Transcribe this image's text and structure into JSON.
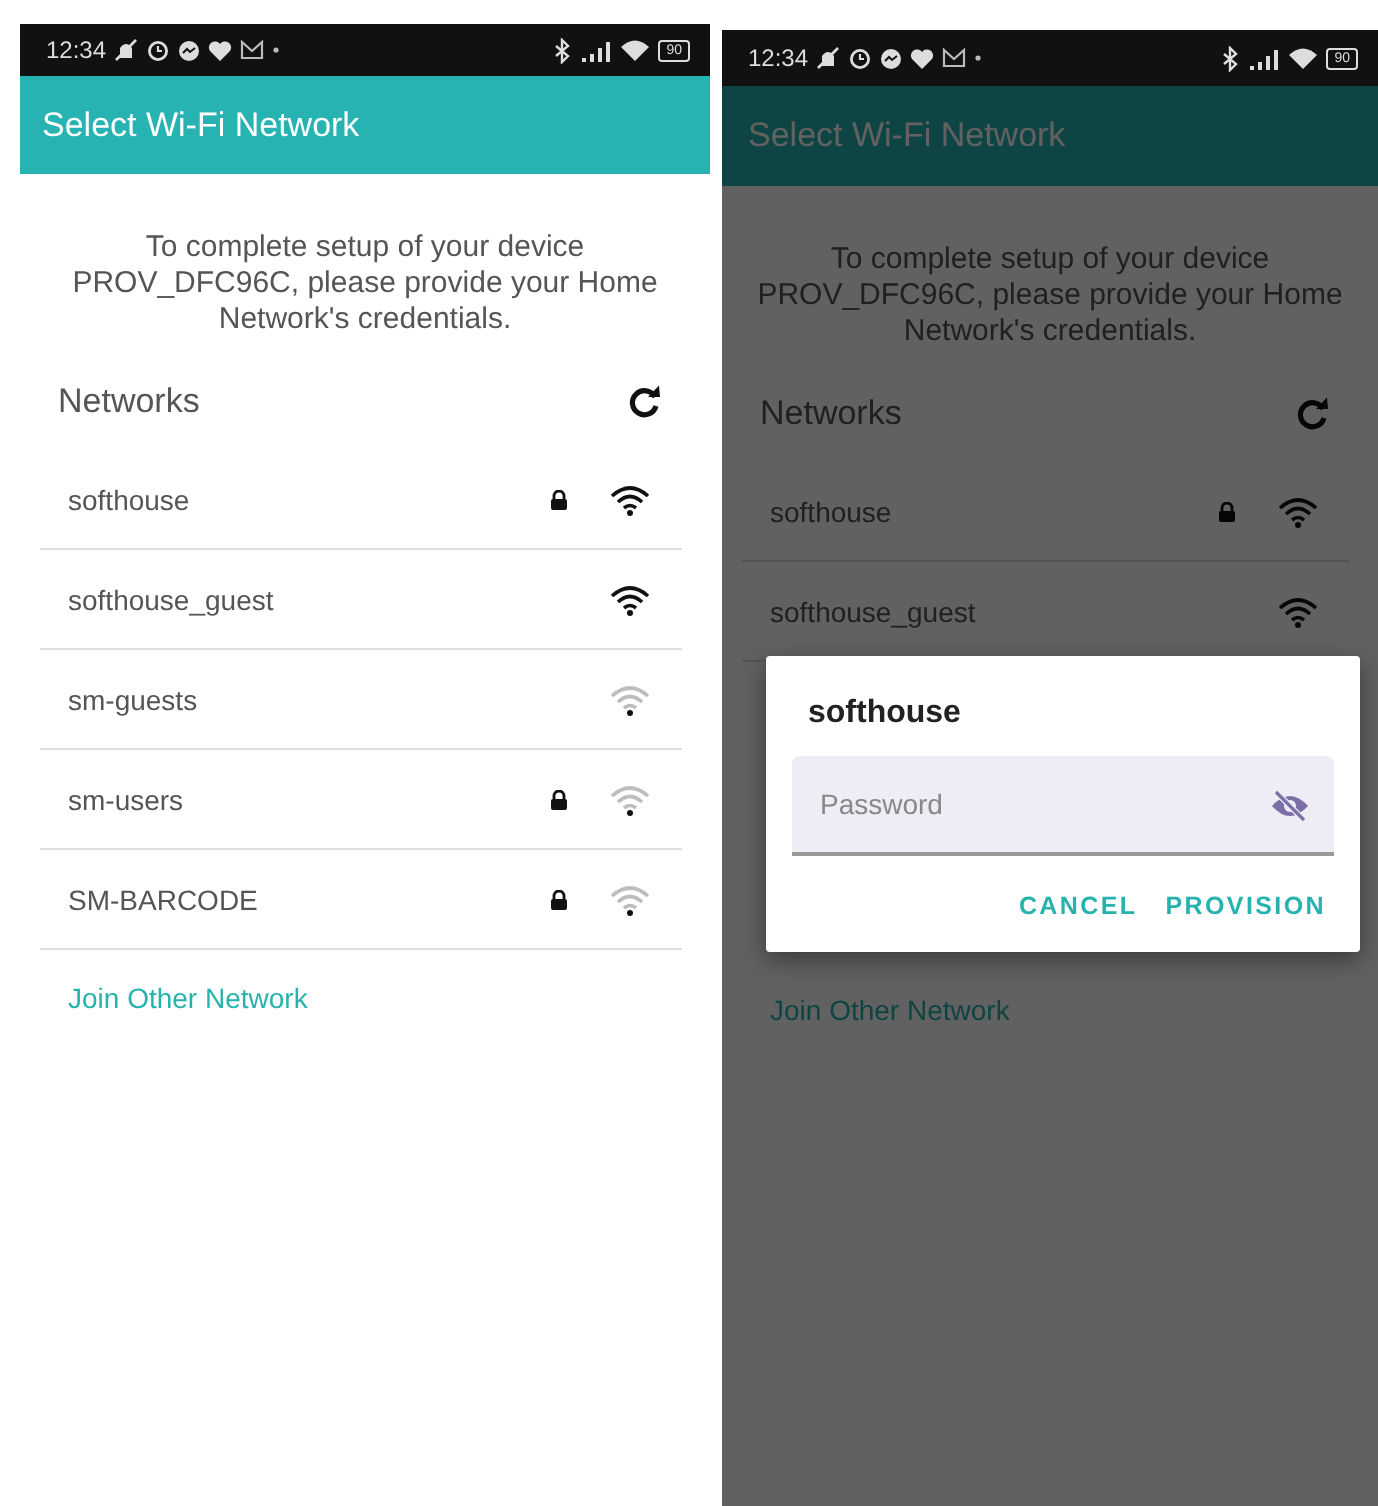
{
  "screens": [
    {
      "status_bar": {
        "time": "12:34",
        "battery": "90"
      },
      "title": "Select Wi-Fi Network",
      "intro": "To complete setup of your device PROV_DFC96C, please provide your Home Network's credentials.",
      "networks_heading": "Networks",
      "networks": [
        {
          "name": "softhouse",
          "secured": true,
          "weak": false
        },
        {
          "name": "softhouse_guest",
          "secured": false,
          "weak": false
        },
        {
          "name": "sm-guests",
          "secured": false,
          "weak": true
        },
        {
          "name": "sm-users",
          "secured": true,
          "weak": true
        },
        {
          "name": "SM-BARCODE",
          "secured": true,
          "weak": true
        }
      ],
      "join_link": "Join Other Network",
      "dimmed": false
    },
    {
      "status_bar": {
        "time": "12:34",
        "battery": "90"
      },
      "title": "Select Wi-Fi Network",
      "intro": "To complete setup of your device PROV_DFC96C, please provide your Home Network's credentials.",
      "networks_heading": "Networks",
      "networks": [
        {
          "name": "softhouse",
          "secured": true,
          "weak": false
        },
        {
          "name": "softhouse_guest",
          "secured": false,
          "weak": false
        }
      ],
      "join_link": "Join Other Network",
      "dimmed": true,
      "dialog": {
        "title": "softhouse",
        "password": {
          "placeholder": "Password"
        },
        "buttons": [
          "CANCEL",
          "PROVISION"
        ]
      }
    }
  ]
}
